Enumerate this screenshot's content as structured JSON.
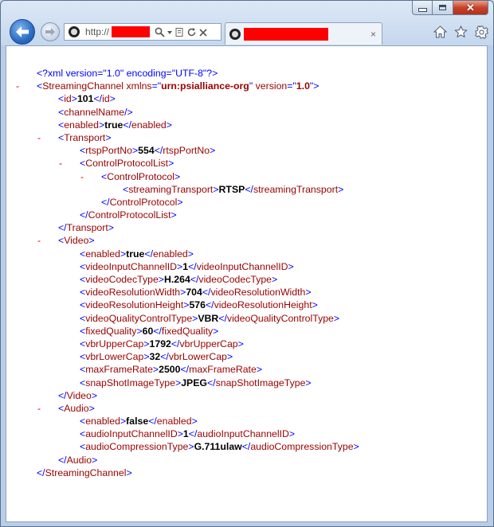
{
  "browser": {
    "url_prefix": "http://",
    "tab_close": "×",
    "colors": {
      "redaction": "#ff0000",
      "bracket": "#0000ff",
      "tag": "#990000",
      "collapse": "#dd0000"
    }
  },
  "xml": {
    "declaration": "<?xml version=\"1.0\" encoding=\"UTF-8\"?>",
    "collapse_glyph": "-",
    "root": {
      "tag": "StreamingChannel",
      "attr1_name": "xmlns",
      "attr1_value": "urn:psialliance-org",
      "attr2_name": "version",
      "attr2_value": "1.0"
    },
    "id": {
      "tag": "id",
      "value": "101"
    },
    "channelName": {
      "tag": "channelName"
    },
    "enabled": {
      "tag": "enabled",
      "value": "true"
    },
    "transport": {
      "tag": "Transport",
      "rtspPortNo": {
        "tag": "rtspPortNo",
        "value": "554"
      },
      "controlProtocolList": {
        "tag": "ControlProtocolList",
        "controlProtocol": {
          "tag": "ControlProtocol",
          "streamingTransport": {
            "tag": "streamingTransport",
            "value": "RTSP"
          }
        }
      }
    },
    "video": {
      "tag": "Video",
      "fields": [
        {
          "tag": "enabled",
          "value": "true"
        },
        {
          "tag": "videoInputChannelID",
          "value": "1"
        },
        {
          "tag": "videoCodecType",
          "value": "H.264"
        },
        {
          "tag": "videoResolutionWidth",
          "value": "704"
        },
        {
          "tag": "videoResolutionHeight",
          "value": "576"
        },
        {
          "tag": "videoQualityControlType",
          "value": "VBR"
        },
        {
          "tag": "fixedQuality",
          "value": "60"
        },
        {
          "tag": "vbrUpperCap",
          "value": "1792"
        },
        {
          "tag": "vbrLowerCap",
          "value": "32"
        },
        {
          "tag": "maxFrameRate",
          "value": "2500"
        },
        {
          "tag": "snapShotImageType",
          "value": "JPEG"
        }
      ]
    },
    "audio": {
      "tag": "Audio",
      "fields": [
        {
          "tag": "enabled",
          "value": "false"
        },
        {
          "tag": "audioInputChannelID",
          "value": "1"
        },
        {
          "tag": "audioCompressionType",
          "value": "G.711ulaw"
        }
      ]
    }
  }
}
